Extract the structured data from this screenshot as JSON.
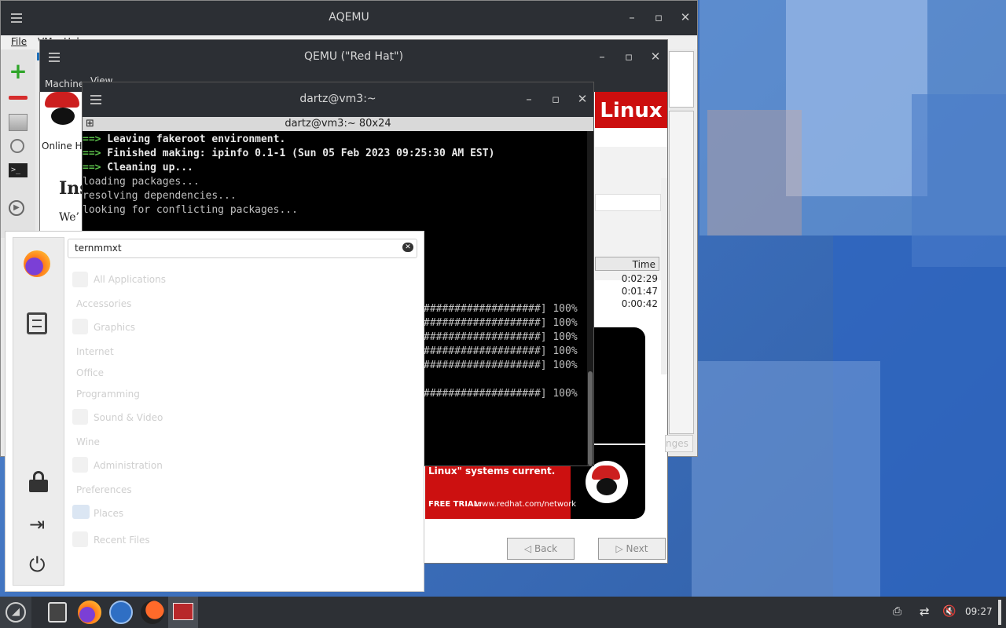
{
  "aqemu": {
    "title": "AQEMU",
    "menu": [
      "File",
      "VM",
      "Help"
    ],
    "tools": [
      "add-icon",
      "remove-icon",
      "storage-icon",
      "clock-icon",
      "terminal-icon",
      "play-icon"
    ]
  },
  "qemu": {
    "title": "QEMU (\"Red Hat\")",
    "menu": [
      "Machine",
      "View"
    ],
    "guest": {
      "brand": "Linux",
      "online_label": "Online H",
      "heading": "Ins",
      "body_start": "We’",
      "table_header": "Time",
      "times": [
        "0:02:29",
        "0:01:47",
        "0:00:42"
      ],
      "ad_text": "Linux\" systems current.",
      "ad_trial": "FREE TRIAL:",
      "ad_url": "www.redhat.com/network",
      "ghost_label": "nges",
      "back": "Back",
      "next": "Next"
    }
  },
  "terminal": {
    "title": "dartz@vm3:~",
    "subtitle": "dartz@vm3:~ 80x24",
    "lines": [
      {
        "prefix": "==>",
        "text": " Leaving fakeroot environment."
      },
      {
        "prefix": "==>",
        "text": " Finished making: ipinfo 0.1-1 (Sun 05 Feb 2023 09:25:30 AM EST)"
      },
      {
        "prefix": "==>",
        "text": " Cleaning up..."
      },
      {
        "prefix": "",
        "text": "loading packages..."
      },
      {
        "prefix": "",
        "text": "resolving dependencies..."
      },
      {
        "prefix": "",
        "text": "looking for conflicting packages..."
      }
    ],
    "progress": [
      "###################] 100%",
      "###################] 100%",
      "###################] 100%",
      "###################] 100%",
      "###################] 100%",
      "###################] 100%"
    ]
  },
  "app_menu": {
    "search_value": "ternmmxt",
    "categories": [
      "All Applications",
      "Accessories",
      "Graphics",
      "Internet",
      "Office",
      "Programming",
      "Sound & Video",
      "Wine",
      "Administration",
      "Preferences",
      "Places",
      "Recent Files"
    ]
  },
  "taskbar": {
    "clock": "09:27"
  }
}
